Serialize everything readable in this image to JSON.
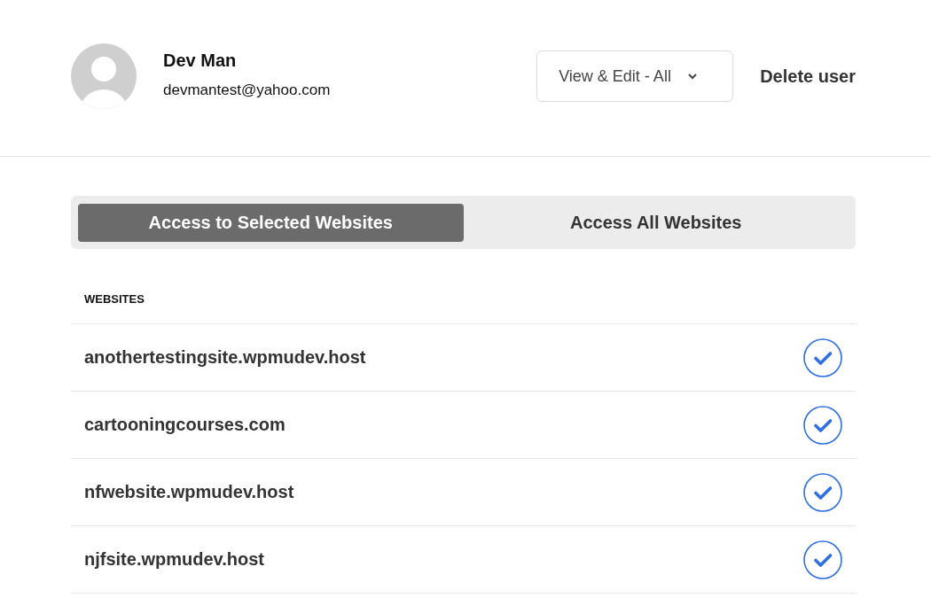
{
  "user": {
    "name": "Dev Man",
    "email": "devmantest@yahoo.com"
  },
  "role_dropdown": {
    "value": "View & Edit - All"
  },
  "delete_button": {
    "label": "Delete user"
  },
  "tabs": [
    {
      "label": "Access to Selected Websites",
      "selected": true
    },
    {
      "label": "Access All Websites",
      "selected": false
    }
  ],
  "websites": {
    "heading": "WEBSITES",
    "rows": [
      {
        "name": "anothertestingsite.wpmudev.host",
        "checked": true
      },
      {
        "name": "cartooningcourses.com",
        "checked": true
      },
      {
        "name": "nfwebsite.wpmudev.host",
        "checked": true
      },
      {
        "name": "njfsite.wpmudev.host",
        "checked": true
      }
    ]
  }
}
